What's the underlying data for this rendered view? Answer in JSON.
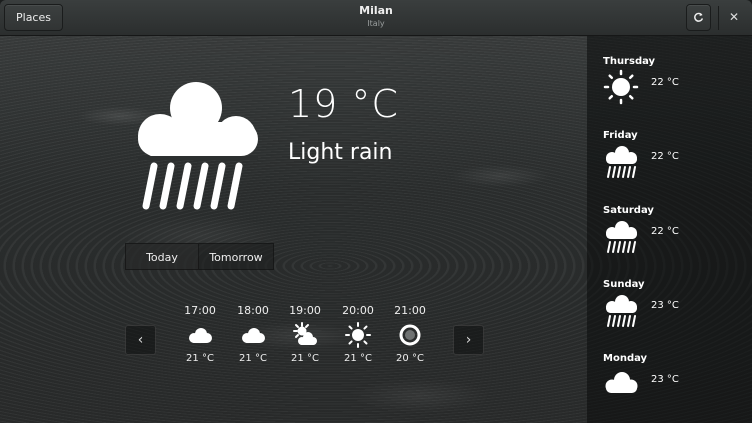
{
  "header": {
    "places_label": "Places",
    "title": "Milan",
    "subtitle": "Italy",
    "refresh_icon": "refresh-icon",
    "close_icon": "close-icon"
  },
  "current": {
    "temperature": "19 °C",
    "condition": "Light rain",
    "icon": "rain-cloud-icon"
  },
  "tabs": [
    {
      "label": "Today",
      "selected": true
    },
    {
      "label": "Tomorrow",
      "selected": false
    }
  ],
  "hourly": [
    {
      "time": "17:00",
      "temp": "21 °C",
      "icon": "cloud-icon"
    },
    {
      "time": "18:00",
      "temp": "21 °C",
      "icon": "cloud-icon"
    },
    {
      "time": "19:00",
      "temp": "21 °C",
      "icon": "sun-cloud-icon"
    },
    {
      "time": "20:00",
      "temp": "21 °C",
      "icon": "sun-icon"
    },
    {
      "time": "21:00",
      "temp": "20 °C",
      "icon": "moon-icon"
    }
  ],
  "forecast": [
    {
      "day": "Thursday",
      "temp": "22 °C",
      "icon": "sun-icon"
    },
    {
      "day": "Friday",
      "temp": "22 °C",
      "icon": "rain-cloud-icon"
    },
    {
      "day": "Saturday",
      "temp": "22 °C",
      "icon": "rain-cloud-icon"
    },
    {
      "day": "Sunday",
      "temp": "23 °C",
      "icon": "rain-cloud-icon"
    },
    {
      "day": "Monday",
      "temp": "23 °C",
      "icon": "cloud-icon"
    }
  ]
}
